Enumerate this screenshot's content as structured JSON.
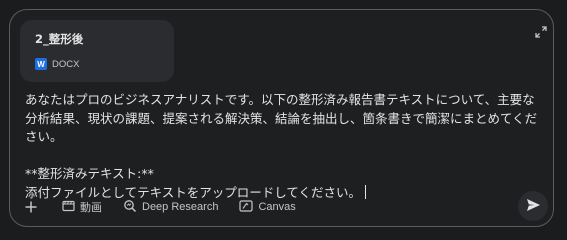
{
  "attachment": {
    "name": "2_整形後",
    "type_label": "DOCX",
    "type_icon": "word-doc-icon",
    "type_icon_letter": "W",
    "type_icon_color": "#1f6fe0"
  },
  "prompt": {
    "paragraph1": "あなたはプロのビジネスアナリストです。以下の整形済み報告書テキストについて、主要な分析結果、現状の課題、提案される解決策、結論を抽出し、箇条書きで簡潔にまとめてください。",
    "heading": "**整形済みテキスト:**",
    "line2": "添付ファイルとしてテキストをアップロードしてください。"
  },
  "toolbar": {
    "add_icon": "plus-icon",
    "tools": [
      {
        "label": "動画",
        "icon": "video-icon"
      },
      {
        "label": "Deep Research",
        "icon": "deep-research-icon"
      },
      {
        "label": "Canvas",
        "icon": "canvas-icon"
      }
    ]
  },
  "actions": {
    "expand_icon": "expand-icon",
    "send_icon": "send-icon"
  },
  "colors": {
    "background": "#1b1c1d",
    "composer_border": "#5a5c60",
    "chip_background": "#2b2c2f",
    "text_primary": "#e3e3e3",
    "text_secondary": "#c4c7c5"
  }
}
